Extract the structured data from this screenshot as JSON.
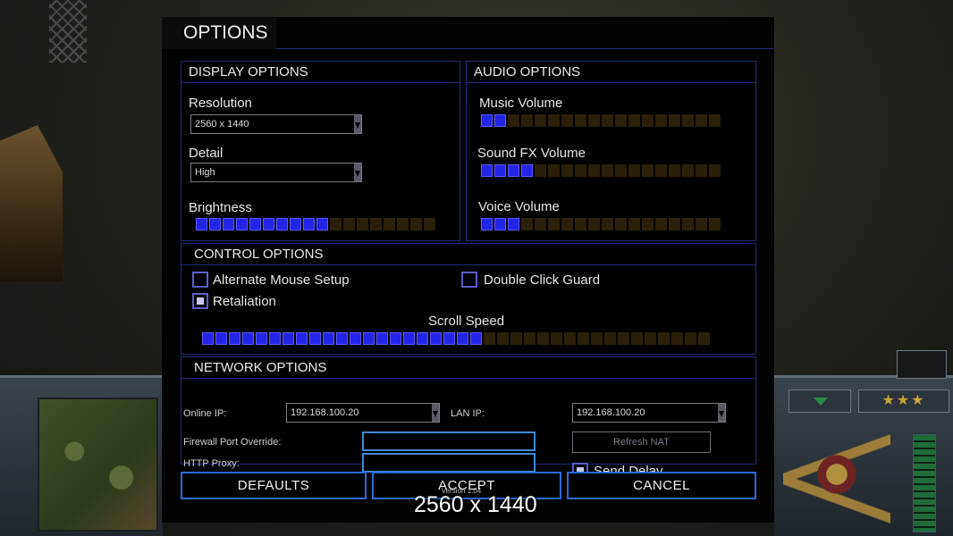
{
  "window": {
    "title": "OPTIONS"
  },
  "display": {
    "heading": "DISPLAY OPTIONS",
    "resolution_label": "Resolution",
    "resolution_value": "2560 x 1440",
    "detail_label": "Detail",
    "detail_value": "High",
    "brightness_label": "Brightness",
    "brightness_level": 10,
    "brightness_segments": 18
  },
  "audio": {
    "heading": "AUDIO OPTIONS",
    "music_label": "Music Volume",
    "music_level": 2,
    "sfx_label": "Sound FX Volume",
    "sfx_level": 4,
    "voice_label": "Voice Volume",
    "voice_level": 3,
    "segments": 18
  },
  "control": {
    "heading": "CONTROL OPTIONS",
    "alt_mouse_label": "Alternate Mouse Setup",
    "alt_mouse_checked": false,
    "double_click_label": "Double Click Guard",
    "double_click_checked": false,
    "retaliation_label": "Retaliation",
    "retaliation_checked": true,
    "scroll_label": "Scroll Speed",
    "scroll_level": 21,
    "scroll_segments": 38
  },
  "network": {
    "heading": "NETWORK OPTIONS",
    "online_ip_label": "Online IP:",
    "online_ip_value": "192.168.100.20",
    "lan_ip_label": "LAN IP:",
    "lan_ip_value": "192.168.100.20",
    "firewall_label": "Firewall Port Override:",
    "firewall_value": "",
    "http_proxy_label": "HTTP Proxy:",
    "http_proxy_value": "",
    "refresh_nat_label": "Refresh NAT",
    "send_delay_label": "Send Delay",
    "send_delay_checked": true
  },
  "buttons": {
    "defaults": "DEFAULTS",
    "accept": "ACCEPT",
    "cancel": "CANCEL"
  },
  "version_text": "Version 1.04",
  "overlay_text": "2560 x 1440",
  "hud": {
    "rank_stars": "★★★"
  },
  "colors": {
    "accent_blue": "#2424e6",
    "frame_blue": "#1e2a7a",
    "button_border": "#2c6ad8"
  }
}
